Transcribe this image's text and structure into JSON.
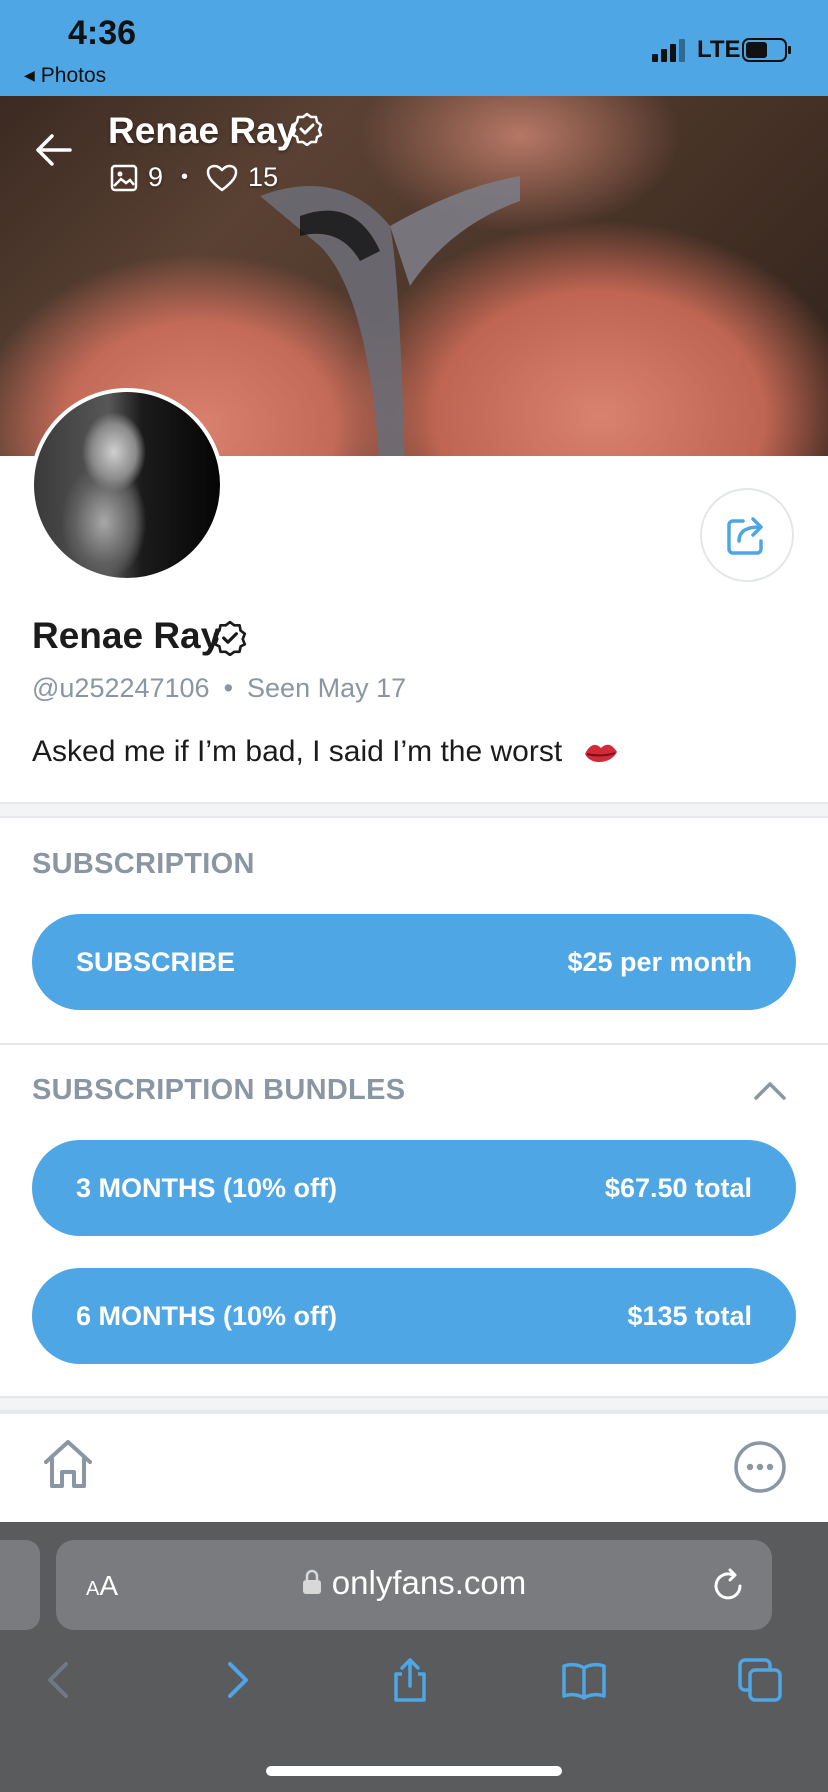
{
  "status_bar": {
    "time": "4:36",
    "back_app": "Photos",
    "network": "LTE"
  },
  "cover": {
    "name": "Renae Ray",
    "photos_count": "9",
    "likes_count": "15",
    "dot": "•"
  },
  "profile": {
    "name": "Renae Ray",
    "username": "@u252247106",
    "separator": "•",
    "seen_label": "Seen",
    "seen_date": "May 17",
    "bio": "Asked me if I’m bad, I said I’m the worst"
  },
  "subscription": {
    "title": "SUBSCRIPTION",
    "button_label": "SUBSCRIBE",
    "price": "$25 per month"
  },
  "bundles": {
    "title": "SUBSCRIPTION BUNDLES",
    "items": [
      {
        "label": "3 MONTHS (10% off)",
        "price": "$67.50 total"
      },
      {
        "label": "6 MONTHS (10% off)",
        "price": "$135 total"
      }
    ]
  },
  "browser": {
    "aa_small": "A",
    "aa_large": "A",
    "url": "onlyfans.com"
  },
  "colors": {
    "accent": "#4ea6e4",
    "muted_text": "#8a96a3",
    "safari_bar": "#5a5b5d"
  },
  "icons": [
    "back-arrow-icon",
    "verified-icon",
    "image-icon",
    "heart-icon",
    "share-icon",
    "chevron-up-icon",
    "home-icon",
    "more-icon",
    "lock-icon",
    "reload-icon",
    "back-icon",
    "forward-icon",
    "share-sheet-icon",
    "bookmarks-icon",
    "tabs-icon"
  ]
}
